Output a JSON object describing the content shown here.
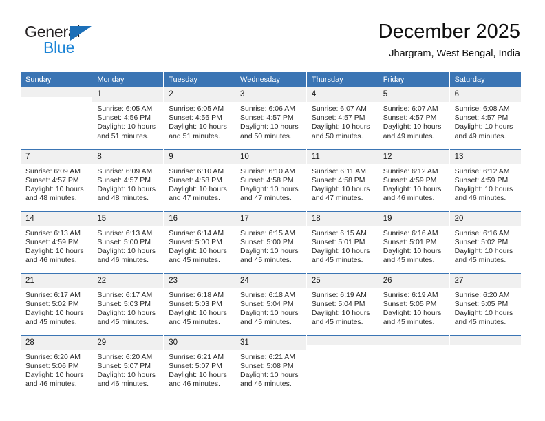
{
  "brand": {
    "name_part1": "General",
    "name_part2": "Blue",
    "triangle_color": "#1c6fb8",
    "blue_color": "#1c84d6"
  },
  "header": {
    "title": "December 2025",
    "subtitle": "Jhargram, West Bengal, India"
  },
  "theme": {
    "header_blue": "#3b75b4",
    "daynum_bg": "#f0f0f0",
    "text_color": "#2a2a2a"
  },
  "weekday_headers": [
    "Sunday",
    "Monday",
    "Tuesday",
    "Wednesday",
    "Thursday",
    "Friday",
    "Saturday"
  ],
  "weeks": [
    [
      {
        "day": "",
        "sunrise": "",
        "sunset": "",
        "daylight1": "",
        "daylight2": "",
        "blank": true
      },
      {
        "day": "1",
        "sunrise": "Sunrise: 6:05 AM",
        "sunset": "Sunset: 4:56 PM",
        "daylight1": "Daylight: 10 hours",
        "daylight2": "and 51 minutes."
      },
      {
        "day": "2",
        "sunrise": "Sunrise: 6:05 AM",
        "sunset": "Sunset: 4:56 PM",
        "daylight1": "Daylight: 10 hours",
        "daylight2": "and 51 minutes."
      },
      {
        "day": "3",
        "sunrise": "Sunrise: 6:06 AM",
        "sunset": "Sunset: 4:57 PM",
        "daylight1": "Daylight: 10 hours",
        "daylight2": "and 50 minutes."
      },
      {
        "day": "4",
        "sunrise": "Sunrise: 6:07 AM",
        "sunset": "Sunset: 4:57 PM",
        "daylight1": "Daylight: 10 hours",
        "daylight2": "and 50 minutes."
      },
      {
        "day": "5",
        "sunrise": "Sunrise: 6:07 AM",
        "sunset": "Sunset: 4:57 PM",
        "daylight1": "Daylight: 10 hours",
        "daylight2": "and 49 minutes."
      },
      {
        "day": "6",
        "sunrise": "Sunrise: 6:08 AM",
        "sunset": "Sunset: 4:57 PM",
        "daylight1": "Daylight: 10 hours",
        "daylight2": "and 49 minutes."
      }
    ],
    [
      {
        "day": "7",
        "sunrise": "Sunrise: 6:09 AM",
        "sunset": "Sunset: 4:57 PM",
        "daylight1": "Daylight: 10 hours",
        "daylight2": "and 48 minutes."
      },
      {
        "day": "8",
        "sunrise": "Sunrise: 6:09 AM",
        "sunset": "Sunset: 4:57 PM",
        "daylight1": "Daylight: 10 hours",
        "daylight2": "and 48 minutes."
      },
      {
        "day": "9",
        "sunrise": "Sunrise: 6:10 AM",
        "sunset": "Sunset: 4:58 PM",
        "daylight1": "Daylight: 10 hours",
        "daylight2": "and 47 minutes."
      },
      {
        "day": "10",
        "sunrise": "Sunrise: 6:10 AM",
        "sunset": "Sunset: 4:58 PM",
        "daylight1": "Daylight: 10 hours",
        "daylight2": "and 47 minutes."
      },
      {
        "day": "11",
        "sunrise": "Sunrise: 6:11 AM",
        "sunset": "Sunset: 4:58 PM",
        "daylight1": "Daylight: 10 hours",
        "daylight2": "and 47 minutes."
      },
      {
        "day": "12",
        "sunrise": "Sunrise: 6:12 AM",
        "sunset": "Sunset: 4:59 PM",
        "daylight1": "Daylight: 10 hours",
        "daylight2": "and 46 minutes."
      },
      {
        "day": "13",
        "sunrise": "Sunrise: 6:12 AM",
        "sunset": "Sunset: 4:59 PM",
        "daylight1": "Daylight: 10 hours",
        "daylight2": "and 46 minutes."
      }
    ],
    [
      {
        "day": "14",
        "sunrise": "Sunrise: 6:13 AM",
        "sunset": "Sunset: 4:59 PM",
        "daylight1": "Daylight: 10 hours",
        "daylight2": "and 46 minutes."
      },
      {
        "day": "15",
        "sunrise": "Sunrise: 6:13 AM",
        "sunset": "Sunset: 5:00 PM",
        "daylight1": "Daylight: 10 hours",
        "daylight2": "and 46 minutes."
      },
      {
        "day": "16",
        "sunrise": "Sunrise: 6:14 AM",
        "sunset": "Sunset: 5:00 PM",
        "daylight1": "Daylight: 10 hours",
        "daylight2": "and 45 minutes."
      },
      {
        "day": "17",
        "sunrise": "Sunrise: 6:15 AM",
        "sunset": "Sunset: 5:00 PM",
        "daylight1": "Daylight: 10 hours",
        "daylight2": "and 45 minutes."
      },
      {
        "day": "18",
        "sunrise": "Sunrise: 6:15 AM",
        "sunset": "Sunset: 5:01 PM",
        "daylight1": "Daylight: 10 hours",
        "daylight2": "and 45 minutes."
      },
      {
        "day": "19",
        "sunrise": "Sunrise: 6:16 AM",
        "sunset": "Sunset: 5:01 PM",
        "daylight1": "Daylight: 10 hours",
        "daylight2": "and 45 minutes."
      },
      {
        "day": "20",
        "sunrise": "Sunrise: 6:16 AM",
        "sunset": "Sunset: 5:02 PM",
        "daylight1": "Daylight: 10 hours",
        "daylight2": "and 45 minutes."
      }
    ],
    [
      {
        "day": "21",
        "sunrise": "Sunrise: 6:17 AM",
        "sunset": "Sunset: 5:02 PM",
        "daylight1": "Daylight: 10 hours",
        "daylight2": "and 45 minutes."
      },
      {
        "day": "22",
        "sunrise": "Sunrise: 6:17 AM",
        "sunset": "Sunset: 5:03 PM",
        "daylight1": "Daylight: 10 hours",
        "daylight2": "and 45 minutes."
      },
      {
        "day": "23",
        "sunrise": "Sunrise: 6:18 AM",
        "sunset": "Sunset: 5:03 PM",
        "daylight1": "Daylight: 10 hours",
        "daylight2": "and 45 minutes."
      },
      {
        "day": "24",
        "sunrise": "Sunrise: 6:18 AM",
        "sunset": "Sunset: 5:04 PM",
        "daylight1": "Daylight: 10 hours",
        "daylight2": "and 45 minutes."
      },
      {
        "day": "25",
        "sunrise": "Sunrise: 6:19 AM",
        "sunset": "Sunset: 5:04 PM",
        "daylight1": "Daylight: 10 hours",
        "daylight2": "and 45 minutes."
      },
      {
        "day": "26",
        "sunrise": "Sunrise: 6:19 AM",
        "sunset": "Sunset: 5:05 PM",
        "daylight1": "Daylight: 10 hours",
        "daylight2": "and 45 minutes."
      },
      {
        "day": "27",
        "sunrise": "Sunrise: 6:20 AM",
        "sunset": "Sunset: 5:05 PM",
        "daylight1": "Daylight: 10 hours",
        "daylight2": "and 45 minutes."
      }
    ],
    [
      {
        "day": "28",
        "sunrise": "Sunrise: 6:20 AM",
        "sunset": "Sunset: 5:06 PM",
        "daylight1": "Daylight: 10 hours",
        "daylight2": "and 46 minutes."
      },
      {
        "day": "29",
        "sunrise": "Sunrise: 6:20 AM",
        "sunset": "Sunset: 5:07 PM",
        "daylight1": "Daylight: 10 hours",
        "daylight2": "and 46 minutes."
      },
      {
        "day": "30",
        "sunrise": "Sunrise: 6:21 AM",
        "sunset": "Sunset: 5:07 PM",
        "daylight1": "Daylight: 10 hours",
        "daylight2": "and 46 minutes."
      },
      {
        "day": "31",
        "sunrise": "Sunrise: 6:21 AM",
        "sunset": "Sunset: 5:08 PM",
        "daylight1": "Daylight: 10 hours",
        "daylight2": "and 46 minutes."
      },
      {
        "day": "",
        "sunrise": "",
        "sunset": "",
        "daylight1": "",
        "daylight2": "",
        "blank": true
      },
      {
        "day": "",
        "sunrise": "",
        "sunset": "",
        "daylight1": "",
        "daylight2": "",
        "blank": true
      },
      {
        "day": "",
        "sunrise": "",
        "sunset": "",
        "daylight1": "",
        "daylight2": "",
        "blank": true
      }
    ]
  ]
}
